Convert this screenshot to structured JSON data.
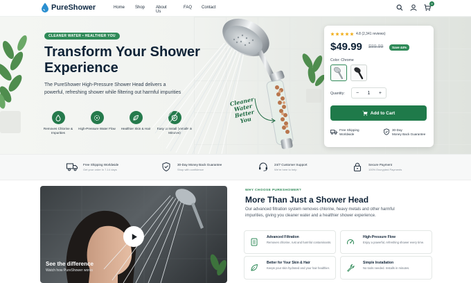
{
  "brand": {
    "name": "PureShower",
    "accent": "#1f7a4a"
  },
  "nav": {
    "items": [
      "Home",
      "Shop",
      "About Us",
      "FAQ",
      "Contact"
    ],
    "cart_count": "0",
    "icons": [
      "search-icon",
      "user-icon",
      "cart-icon"
    ]
  },
  "hero": {
    "tag": "CLEANER WATER • HEALTHIER YOU",
    "title": "Transform Your Shower Experience",
    "description": "The PureShower High-Pressure Shower Head delivers a powerful, refreshing shower while filtering out harmful impurities.",
    "script_text": "Cleaner Water Better You",
    "features": [
      {
        "label": "Removes Chlorine & Impurities",
        "icon": "droplet-icon"
      },
      {
        "label": "High-Pressure Water Flow",
        "icon": "pressure-icon"
      },
      {
        "label": "Healthier Skin & Hair",
        "icon": "leaf-icon"
      },
      {
        "label": "Easy to Install (Installs in Minutes)",
        "icon": "shield-check-icon"
      }
    ]
  },
  "product": {
    "rating": "4.8 (2,341 reviews)",
    "stars": 5,
    "price": "$49.99",
    "old_price": "$89.99",
    "save_badge": "Save 44%",
    "color_label": "Color: Chrome",
    "quantity_label": "Quantity:",
    "quantity": "1",
    "minus": "−",
    "plus": "+",
    "add_to_cart": "Add to Cart",
    "perks": [
      {
        "title": "Free Shipping",
        "sub": "Worldwide",
        "icon": "truck-icon"
      },
      {
        "title": "30-Day",
        "sub": "Money Back Guarantee",
        "icon": "shield-icon"
      }
    ]
  },
  "trust": [
    {
      "title": "Free Shipping Worldwide",
      "sub": "Get your order in 7-14 days",
      "icon": "truck-icon"
    },
    {
      "title": "30-Day Money Back Guarantee",
      "sub": "Shop with confidence",
      "icon": "shield-icon"
    },
    {
      "title": "24/7 Customer Support",
      "sub": "We're here to help",
      "icon": "headset-icon"
    },
    {
      "title": "Secure Payment",
      "sub": "100% Encrypted Payments",
      "icon": "lock-icon"
    }
  ],
  "video": {
    "title": "See the difference",
    "sub": "Watch how PureShower works"
  },
  "why": {
    "tag": "WHY CHOOSE PURESHOWER?",
    "title": "More Than Just a Shower Head",
    "description": "Our advanced filtration system removes chlorine, heavy metals and other harmful impurities, giving you cleaner water and a healthier shower experience.",
    "benefits": [
      {
        "title": "Advanced Filtration",
        "desc": "Removes chlorine, rust and harmful contaminants.",
        "icon": "filter-icon"
      },
      {
        "title": "High-Pressure Flow",
        "desc": "Enjoy a powerful, refreshing shower every time.",
        "icon": "pressure-icon"
      },
      {
        "title": "Better for Your Skin & Hair",
        "desc": "Keeps your skin hydrated and your hair healthier.",
        "icon": "leaf-icon"
      },
      {
        "title": "Simple Installation",
        "desc": "No tools needed. Installs in minutes.",
        "icon": "wrench-icon"
      }
    ]
  }
}
